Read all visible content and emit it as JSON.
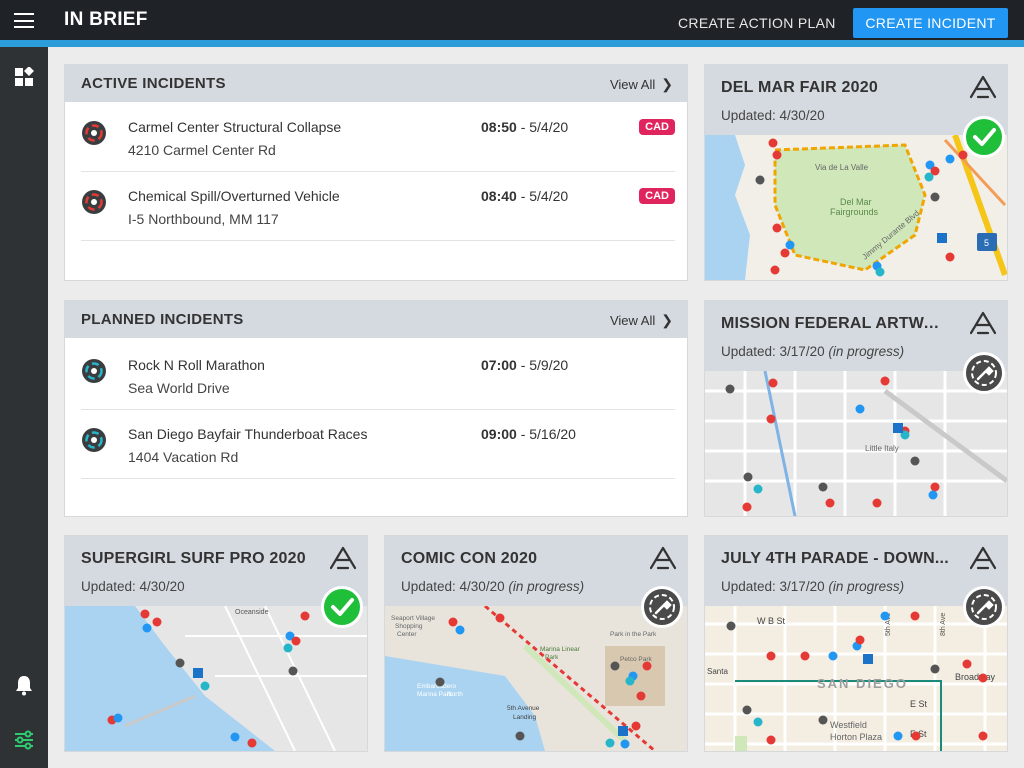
{
  "app": {
    "title": "IN BRIEF",
    "create_action_plan": "CREATE ACTION PLAN",
    "create_incident": "CREATE INCIDENT"
  },
  "active_incidents": {
    "title": "ACTIVE INCIDENTS",
    "view_all": "View All",
    "items": [
      {
        "name": "Carmel Center Structural Collapse",
        "address": "4210 Carmel Center Rd",
        "time": "08:50",
        "date": " - 5/4/20",
        "badge": "CAD"
      },
      {
        "name": "Chemical Spill/Overturned Vehicle",
        "address": "I-5 Northbound, MM 117",
        "time": "08:40",
        "date": " - 5/4/20",
        "badge": "CAD"
      }
    ]
  },
  "planned_incidents": {
    "title": "PLANNED INCIDENTS",
    "view_all": "View All",
    "items": [
      {
        "name": "Rock N Roll Marathon",
        "address": "Sea World Drive",
        "time": "07:00",
        "date": " - 5/9/20"
      },
      {
        "name": "San Diego Bayfair Thunderboat Races",
        "address": "1404 Vacation Rd",
        "time": "09:00",
        "date": " - 5/16/20"
      }
    ]
  },
  "cards": [
    {
      "title": "DEL MAR FAIR 2020",
      "updated": "Updated: 4/30/20",
      "progress": "",
      "status": "complete"
    },
    {
      "title": "MISSION FEDERAL ARTWALK",
      "updated": "Updated: 3/17/20",
      "progress": "(in progress)",
      "status": "in-progress"
    },
    {
      "title": "SUPERGIRL SURF PRO 2020",
      "updated": "Updated: 4/30/20",
      "progress": "",
      "status": "complete"
    },
    {
      "title": "COMIC CON 2020",
      "updated": "Updated: 4/30/20",
      "progress": "(in progress)",
      "status": "in-progress"
    },
    {
      "title": "JULY 4TH PARADE - DOWN...",
      "updated": "Updated: 3/17/20",
      "progress": "(in progress)",
      "status": "in-progress"
    }
  ],
  "map_labels": {
    "delmar": [
      "Via de La Valle",
      "Del Mar",
      "Fairgrounds",
      "Jimmy Durante Blvd",
      "5"
    ],
    "artwalk": [
      "Little Italy"
    ],
    "surf": [
      "Oceanside"
    ],
    "comiccon": [
      "Seaport Village",
      "Shopping",
      "Center",
      "Park in the Park",
      "Petco Park",
      "Embarcadero",
      "Marina Park",
      "North",
      "5th Avenue",
      "Landing",
      "Marina Linear",
      "Park"
    ],
    "parade": [
      "W B St",
      "SAN DIEGO",
      "Broadway",
      "E St",
      "F St",
      "Westfield",
      "Horton Plaza",
      "Santa",
      "8th Ave",
      "5th Ave"
    ]
  },
  "colors": {
    "accent": "#2196f3",
    "cad": "#e0245e",
    "success": "#1fbf3a",
    "pending": "#4a4a4a"
  }
}
